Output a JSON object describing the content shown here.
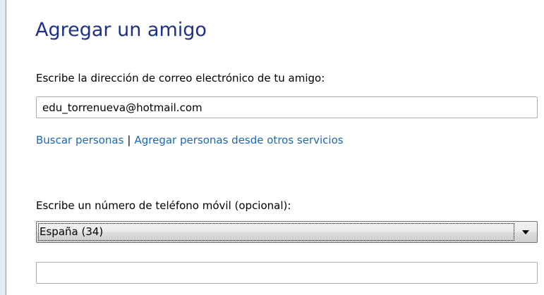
{
  "dialog": {
    "title": "Agregar un amigo"
  },
  "email": {
    "label": "Escribe la dirección de correo electrónico de tu amigo:",
    "value": "edu_torrenueva@hotmail.com"
  },
  "links": {
    "search_people": "Buscar personas",
    "separator": "|",
    "add_from_services": "Agregar personas desde otros servicios"
  },
  "phone": {
    "label": "Escribe un número de teléfono móvil (opcional):",
    "country_selected": "España (34)",
    "number_value": ""
  },
  "icons": {
    "dropdown": "chevron-down-icon"
  },
  "colors": {
    "title": "#1e3287",
    "link": "#1a67b8"
  }
}
